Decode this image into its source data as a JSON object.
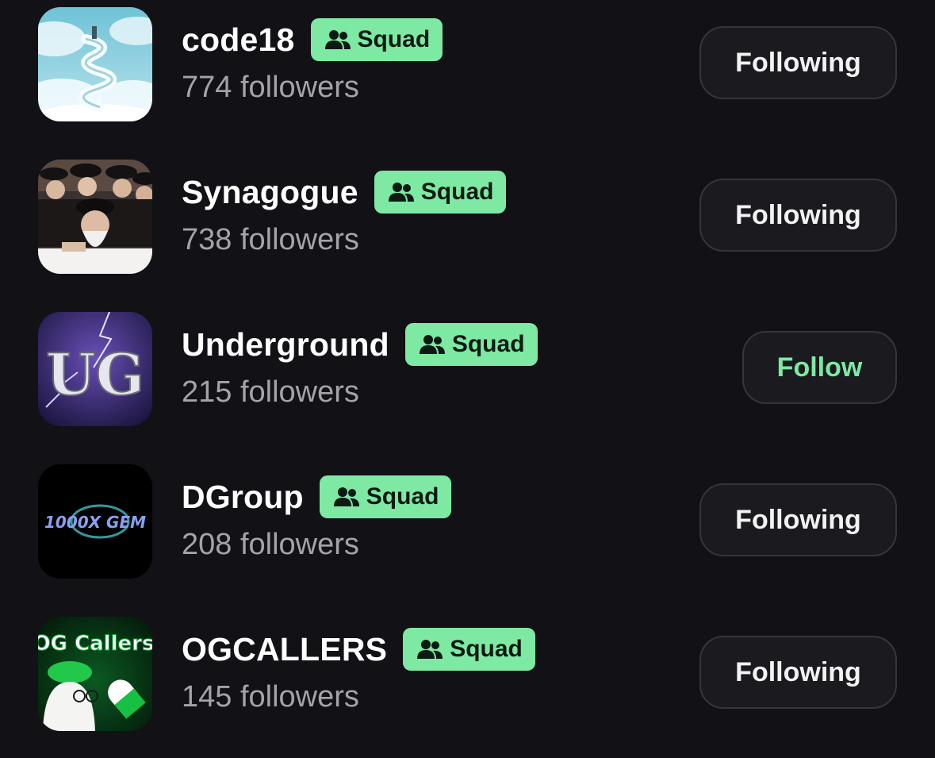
{
  "badge_label": "Squad",
  "accent_color": "#7ee9a3",
  "rows": [
    {
      "name": "code18",
      "followers": "774 followers",
      "button": "Following",
      "avatar_icon": "spiral-staircase-clouds-avatar"
    },
    {
      "name": "Synagogue",
      "followers": "738 followers",
      "button": "Following",
      "avatar_icon": "group-photo-avatar"
    },
    {
      "name": "Underground",
      "followers": "215 followers",
      "button": "Follow",
      "avatar_icon": "ug-logo-avatar"
    },
    {
      "name": "DGroup",
      "followers": "208 followers",
      "button": "Following",
      "avatar_icon": "1000x-gem-avatar",
      "avatar_text": "1000X GEM"
    },
    {
      "name": "OGCALLERS",
      "followers": "145 followers",
      "button": "Following",
      "avatar_icon": "og-callers-avatar",
      "avatar_text": "OG Callers"
    }
  ]
}
